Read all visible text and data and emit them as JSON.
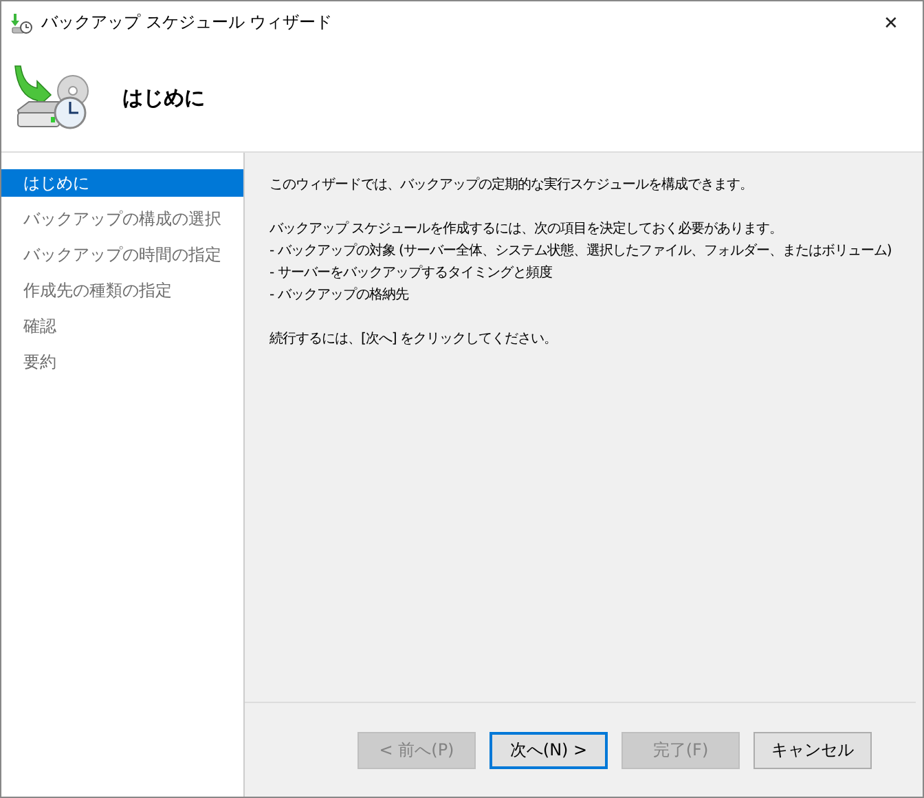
{
  "window": {
    "title": "バックアップ スケジュール ウィザード",
    "close_glyph": "✕"
  },
  "header": {
    "title": "はじめに"
  },
  "steps": [
    {
      "label": "はじめに",
      "selected": true
    },
    {
      "label": "バックアップの構成の選択",
      "selected": false
    },
    {
      "label": "バックアップの時間の指定",
      "selected": false
    },
    {
      "label": "作成先の種類の指定",
      "selected": false
    },
    {
      "label": "確認",
      "selected": false
    },
    {
      "label": "要約",
      "selected": false
    }
  ],
  "content": {
    "intro": "このウィザードでは、バックアップの定期的な実行スケジュールを構成できます。",
    "requirements_heading": "バックアップ スケジュールを作成するには、次の項目を決定しておく必要があります。",
    "requirements": [
      "-  バックアップの対象 (サーバー全体、システム状態、選択したファイル、フォルダー、またはボリューム)",
      "-  サーバーをバックアップするタイミングと頻度",
      "-  バックアップの格納先"
    ],
    "continue": "続行するには、[次へ] をクリックしてください。"
  },
  "buttons": [
    {
      "label": "< 前へ(P)",
      "disabled": true,
      "default": false
    },
    {
      "label": "次へ(N) >",
      "disabled": false,
      "default": true
    },
    {
      "label": "完了(F)",
      "disabled": true,
      "default": false
    },
    {
      "label": "キャンセル",
      "disabled": false,
      "default": false
    }
  ]
}
